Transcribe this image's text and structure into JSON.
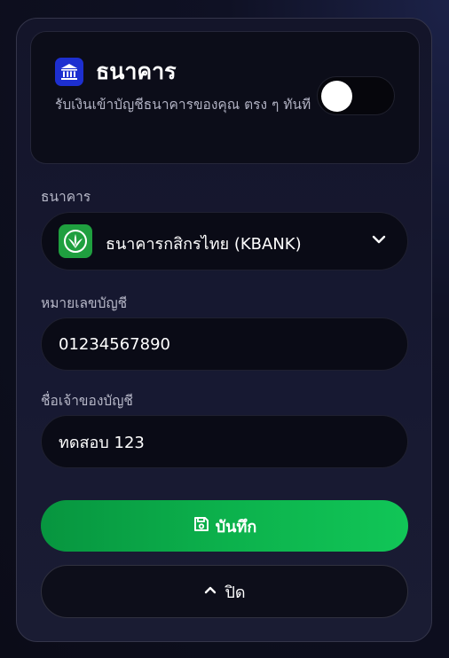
{
  "header": {
    "title": "ธนาคาร",
    "description": "รับเงินเข้าบัญชีธนาคารของคุณ ตรง ๆ ทันที",
    "icon": "bank-icon",
    "toggle_on": false
  },
  "fields": {
    "bank": {
      "label": "ธนาคาร",
      "value": "ธนาคารกสิกรไทย (KBANK)",
      "logo": "kbank-logo-icon"
    },
    "account_number": {
      "label": "หมายเลขบัญชี",
      "value": "01234567890"
    },
    "account_name": {
      "label": "ชื่อเจ้าของบัญชี",
      "value": "ทดสอบ 123"
    }
  },
  "actions": {
    "save_label": "บันทึก",
    "close_label": "ปิด"
  },
  "colors": {
    "accent_green": "#0cb14c",
    "bank_icon_bg": "#1d2fd0",
    "kbank_green": "#1f9f3f"
  }
}
